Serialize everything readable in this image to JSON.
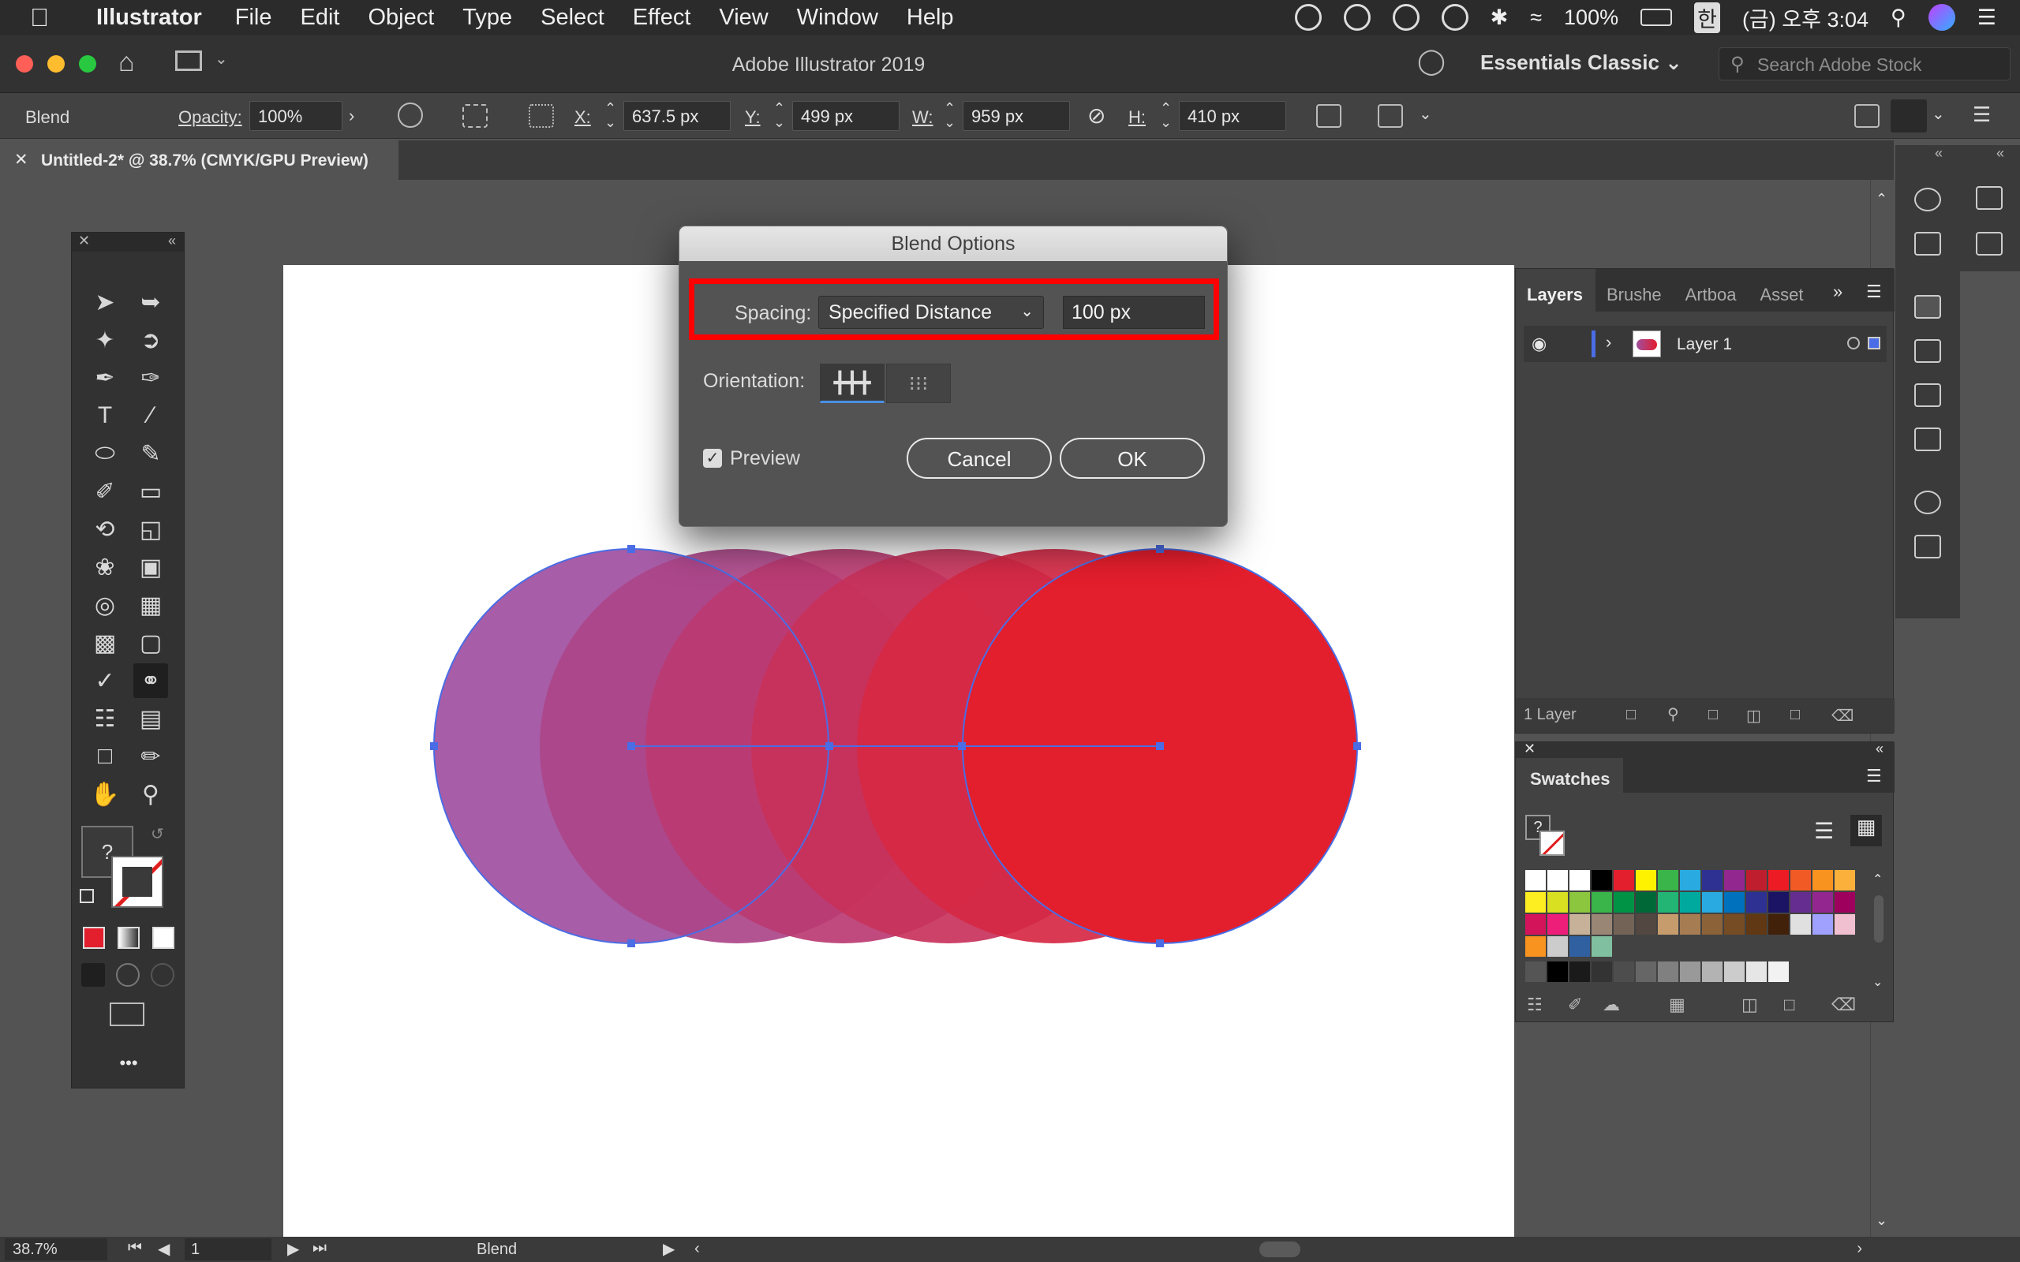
{
  "menubar": {
    "app_name": "Illustrator",
    "items": [
      "File",
      "Edit",
      "Object",
      "Type",
      "Select",
      "Effect",
      "View",
      "Window",
      "Help"
    ],
    "battery": "100%",
    "input_source": "한",
    "clock": "(금) 오후 3:04"
  },
  "window": {
    "title": "Adobe Illustrator 2019",
    "workspace": "Essentials Classic",
    "stock_search_placeholder": "Search Adobe Stock"
  },
  "control_bar": {
    "selection_type": "Blend",
    "opacity_label": "Opacity:",
    "opacity_value": "100%",
    "x_label": "X:",
    "x_value": "637.5 px",
    "y_label": "Y:",
    "y_value": "499 px",
    "w_label": "W:",
    "w_value": "959 px",
    "h_label": "H:",
    "h_value": "410 px"
  },
  "document_tab": {
    "title": "Untitled-2* @ 38.7% (CMYK/GPU Preview)"
  },
  "dialog": {
    "title": "Blend Options",
    "spacing_label": "Spacing:",
    "spacing_value": "Specified Distance",
    "distance_value": "100 px",
    "orientation_label": "Orientation:",
    "preview_label": "Preview",
    "preview_checked": true,
    "cancel_label": "Cancel",
    "ok_label": "OK"
  },
  "layers_panel": {
    "tabs": [
      "Layers",
      "Brushe",
      "Artboa",
      "Asset"
    ],
    "layer_name": "Layer 1",
    "footer_count": "1 Layer"
  },
  "swatches_panel": {
    "title": "Swatches",
    "fill_question": "?"
  },
  "tools_panel": {
    "fill_question": "?",
    "more": "•••"
  },
  "status_bar": {
    "zoom": "38.7%",
    "artboard_number": "1",
    "tool_mode": "Blend"
  },
  "colors": {
    "blend_start": "#a04fa0",
    "blend_end": "#e31e2d",
    "selection_blue": "#4a6de5",
    "highlight_red": "#ff0000"
  }
}
